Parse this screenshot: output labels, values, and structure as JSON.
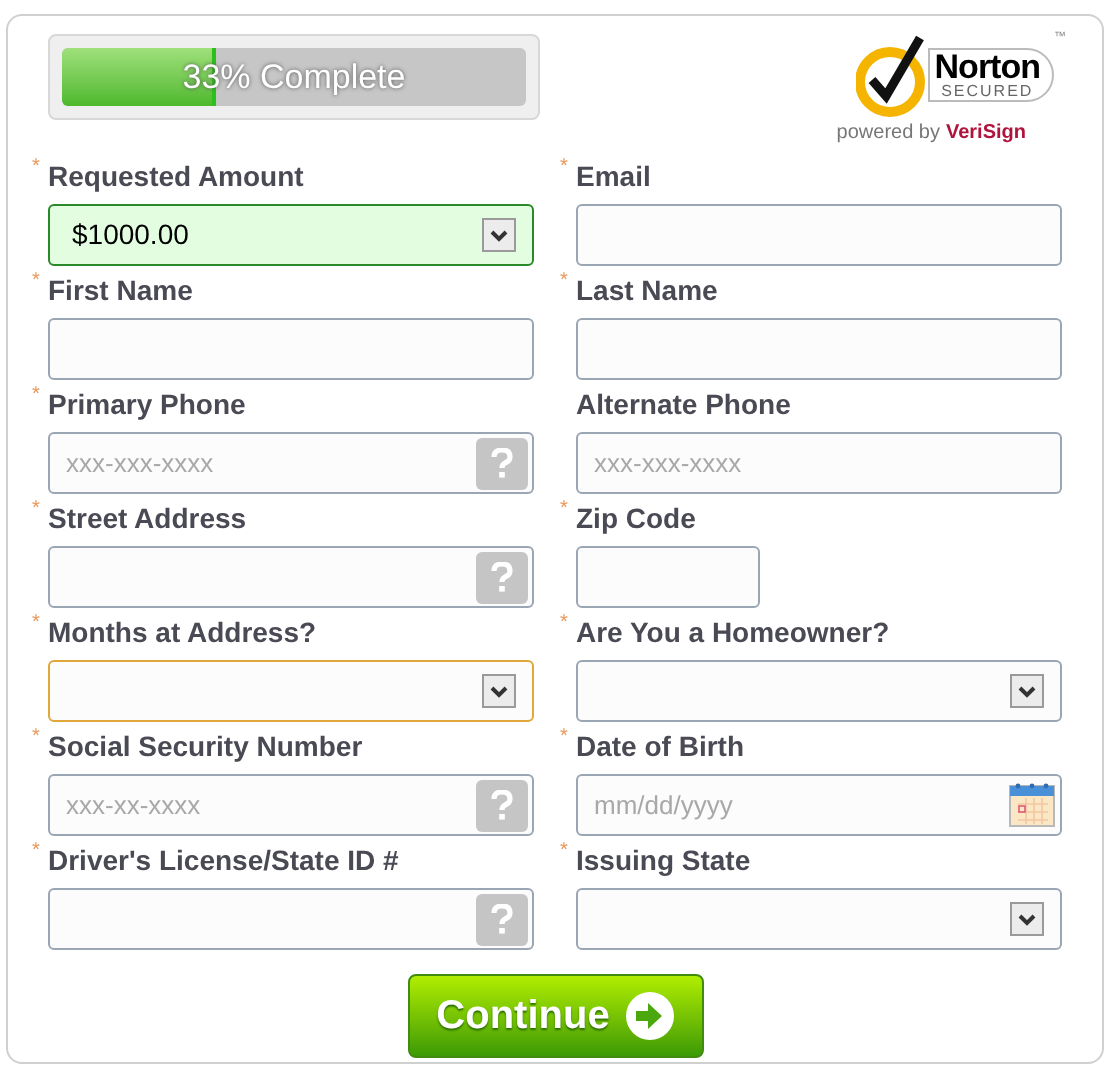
{
  "progress": {
    "level": 0.33,
    "label": "33% Complete"
  },
  "badge": {
    "brand": "Norton",
    "secured": "SECURED",
    "trademark": "™",
    "powered_by": "powered by",
    "partner": "VeriSign"
  },
  "fields": [
    {
      "asterisk": "*",
      "label": "Requested Amount",
      "kind": "select",
      "value": "$1000.00",
      "valid": true,
      "focused": false,
      "help": false
    },
    {
      "asterisk": "*",
      "label": "Email",
      "kind": "text",
      "valid": false,
      "focused": false,
      "help": false
    },
    {
      "asterisk": "*",
      "label": "First Name",
      "kind": "text",
      "valid": false,
      "focused": false,
      "help": false
    },
    {
      "asterisk": "*",
      "label": "Last Name",
      "kind": "text",
      "valid": false,
      "focused": false,
      "help": false
    },
    {
      "asterisk": "*",
      "label": "Primary Phone",
      "kind": "text",
      "placeholder": "xxx-xxx-xxxx",
      "valid": false,
      "focused": false,
      "help": true
    },
    {
      "label": "Alternate Phone",
      "kind": "text",
      "placeholder": "xxx-xxx-xxxx",
      "valid": false,
      "focused": false,
      "help": false
    },
    {
      "asterisk": "*",
      "label": "Street Address",
      "kind": "text",
      "valid": false,
      "focused": false,
      "help": true
    },
    {
      "asterisk": "*",
      "label": "Zip Code",
      "kind": "short",
      "valid": false,
      "focused": false,
      "help": false
    },
    {
      "asterisk": "*",
      "label": "Months at Address?",
      "kind": "select",
      "valid": false,
      "focused": true,
      "help": false
    },
    {
      "asterisk": "*",
      "label": "Are You a Homeowner?",
      "kind": "select",
      "valid": false,
      "focused": false,
      "help": false
    },
    {
      "asterisk": "*",
      "label": "Social Security Number",
      "kind": "text",
      "placeholder": "xxx-xx-xxxx",
      "valid": false,
      "focused": false,
      "help": true
    },
    {
      "asterisk": "*",
      "label": "Date of Birth",
      "kind": "date",
      "placeholder": "mm/dd/yyyy",
      "valid": false,
      "focused": false,
      "help": false
    },
    {
      "asterisk": "*",
      "label": "Driver's License/State ID #",
      "kind": "text",
      "valid": false,
      "focused": false,
      "help": true
    },
    {
      "asterisk": "*",
      "label": "Issuing State",
      "kind": "select",
      "valid": false,
      "focused": false,
      "help": false
    }
  ],
  "submit": {
    "label": "Continue"
  }
}
